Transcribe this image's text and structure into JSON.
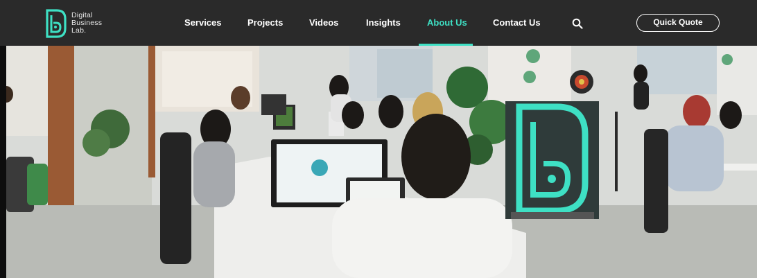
{
  "brand": {
    "name_line1": "Digital",
    "name_line2": "Business",
    "name_line3": "Lab.",
    "accent_color": "#3ee0c4"
  },
  "nav": {
    "items": [
      {
        "label": "Services",
        "active": false
      },
      {
        "label": "Projects",
        "active": false
      },
      {
        "label": "Videos",
        "active": false
      },
      {
        "label": "Insights",
        "active": false
      },
      {
        "label": "About Us",
        "active": true
      },
      {
        "label": "Contact Us",
        "active": false
      }
    ],
    "search_icon": "search-icon",
    "cta_label": "Quick Quote"
  },
  "hero": {
    "image_subject": "office-team-photo",
    "sign_icon": "db-neon-logo"
  }
}
